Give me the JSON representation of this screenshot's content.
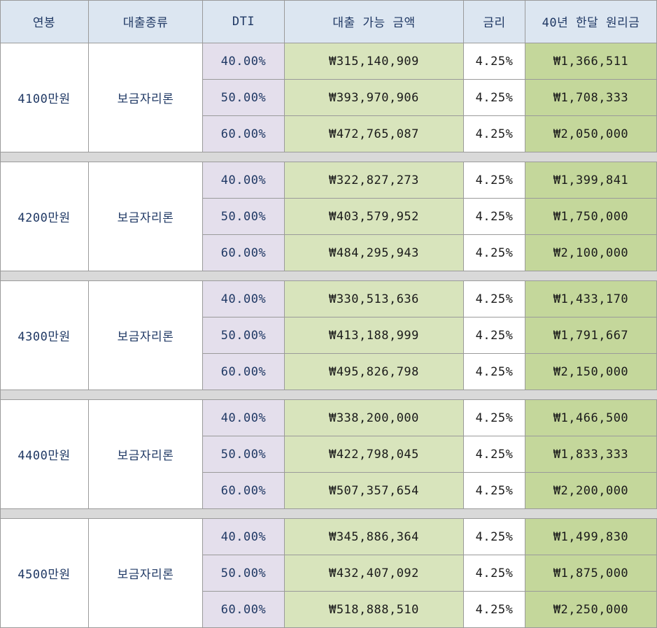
{
  "header": {
    "income": "연봉",
    "loan_type": "대출종류",
    "dti": "DTI",
    "loan_amount": "대출 가능 금액",
    "rate": "금리",
    "monthly_payment": "40년 한달 원리금"
  },
  "groups": [
    {
      "income": "4100만원",
      "loan_type": "보금자리론",
      "rows": [
        {
          "dti": "40.00%",
          "amount": "₩315,140,909",
          "rate": "4.25%",
          "payment": "₩1,366,511"
        },
        {
          "dti": "50.00%",
          "amount": "₩393,970,906",
          "rate": "4.25%",
          "payment": "₩1,708,333"
        },
        {
          "dti": "60.00%",
          "amount": "₩472,765,087",
          "rate": "4.25%",
          "payment": "₩2,050,000"
        }
      ]
    },
    {
      "income": "4200만원",
      "loan_type": "보금자리론",
      "rows": [
        {
          "dti": "40.00%",
          "amount": "₩322,827,273",
          "rate": "4.25%",
          "payment": "₩1,399,841"
        },
        {
          "dti": "50.00%",
          "amount": "₩403,579,952",
          "rate": "4.25%",
          "payment": "₩1,750,000"
        },
        {
          "dti": "60.00%",
          "amount": "₩484,295,943",
          "rate": "4.25%",
          "payment": "₩2,100,000"
        }
      ]
    },
    {
      "income": "4300만원",
      "loan_type": "보금자리론",
      "rows": [
        {
          "dti": "40.00%",
          "amount": "₩330,513,636",
          "rate": "4.25%",
          "payment": "₩1,433,170"
        },
        {
          "dti": "50.00%",
          "amount": "₩413,188,999",
          "rate": "4.25%",
          "payment": "₩1,791,667"
        },
        {
          "dti": "60.00%",
          "amount": "₩495,826,798",
          "rate": "4.25%",
          "payment": "₩2,150,000"
        }
      ]
    },
    {
      "income": "4400만원",
      "loan_type": "보금자리론",
      "rows": [
        {
          "dti": "40.00%",
          "amount": "₩338,200,000",
          "rate": "4.25%",
          "payment": "₩1,466,500"
        },
        {
          "dti": "50.00%",
          "amount": "₩422,798,045",
          "rate": "4.25%",
          "payment": "₩1,833,333"
        },
        {
          "dti": "60.00%",
          "amount": "₩507,357,654",
          "rate": "4.25%",
          "payment": "₩2,200,000"
        }
      ]
    },
    {
      "income": "4500만원",
      "loan_type": "보금자리론",
      "rows": [
        {
          "dti": "40.00%",
          "amount": "₩345,886,364",
          "rate": "4.25%",
          "payment": "₩1,499,830"
        },
        {
          "dti": "50.00%",
          "amount": "₩432,407,092",
          "rate": "4.25%",
          "payment": "₩1,875,000"
        },
        {
          "dti": "60.00%",
          "amount": "₩518,888,510",
          "rate": "4.25%",
          "payment": "₩2,250,000"
        }
      ]
    }
  ]
}
